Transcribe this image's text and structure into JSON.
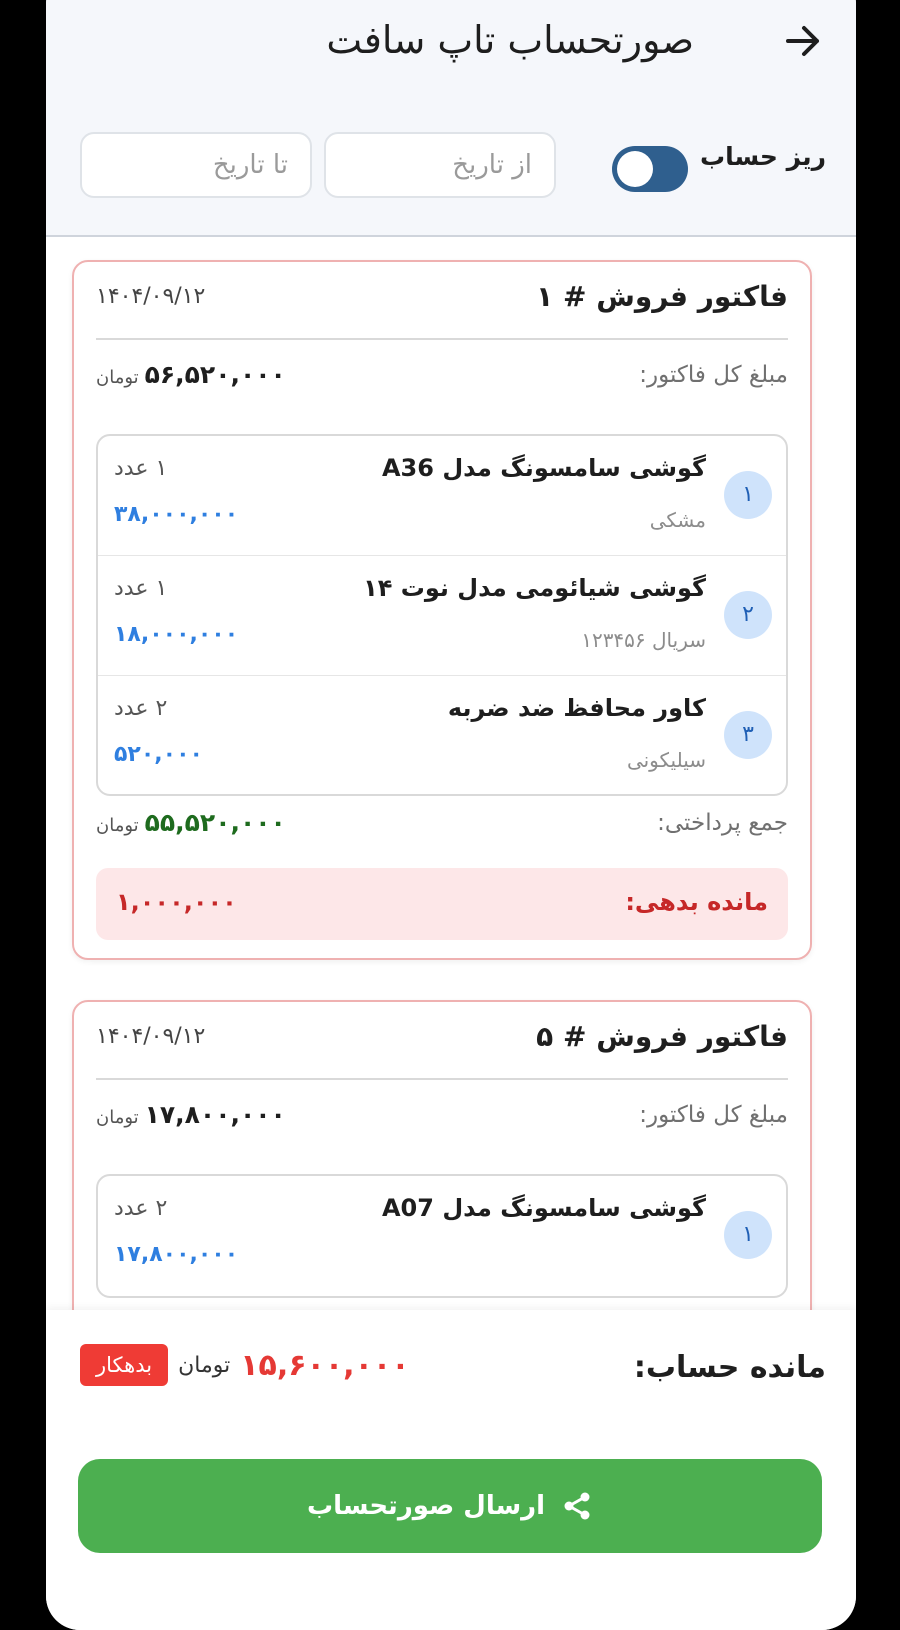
{
  "header": {
    "title": "صورتحساب تاپ سافت",
    "toggle_label": "ریز حساب",
    "from_date_placeholder": "از تاریخ",
    "to_date_placeholder": "تا تاریخ"
  },
  "labels": {
    "invoice_total": "مبلغ کل فاکتور:",
    "paid_total": "جمع پرداختی:",
    "debt": "مانده بدهی:",
    "currency": "تومان"
  },
  "invoices": [
    {
      "title": "فاکتور فروش # ۱",
      "date": "۱۴۰۴/۰۹/۱۲",
      "total": "۵۶,۵۲۰,۰۰۰",
      "items": [
        {
          "index": "۱",
          "name": "گوشی سامسونگ مدل A36",
          "sub": "مشکی",
          "qty": "۱ عدد",
          "price": "۳۸,۰۰۰,۰۰۰"
        },
        {
          "index": "۲",
          "name": "گوشی شیائومی مدل نوت ۱۴",
          "sub": "سریال ۱۲۳۴۵۶",
          "qty": "۱ عدد",
          "price": "۱۸,۰۰۰,۰۰۰"
        },
        {
          "index": "۳",
          "name": "کاور محافظ ضد ضربه",
          "sub": "سیلیکونی",
          "qty": "۲ عدد",
          "price": "۵۲۰,۰۰۰"
        }
      ],
      "paid": "۵۵,۵۲۰,۰۰۰",
      "debt": "۱,۰۰۰,۰۰۰"
    },
    {
      "title": "فاکتور فروش # ۵",
      "date": "۱۴۰۴/۰۹/۱۲",
      "total": "۱۷,۸۰۰,۰۰۰",
      "items": [
        {
          "index": "۱",
          "name": "گوشی سامسونگ مدل A07",
          "qty": "۲ عدد",
          "price": "۱۷,۸۰۰,۰۰۰"
        }
      ]
    }
  ],
  "footer": {
    "balance_label": "مانده حساب:",
    "balance_value": "۱۵,۶۰۰,۰۰۰",
    "currency": "تومان",
    "status_tag": "بدهکار",
    "send_button": "ارسال صورتحساب"
  },
  "colors": {
    "toggle_track": "#2f5f8e",
    "invoice_border": "#efb1b1",
    "price_blue": "#2f7fe0",
    "paid_green": "#1e6b1e",
    "debt_red": "#c62828",
    "send_green": "#4caf50"
  },
  "icons": {
    "back": "arrow-right-icon",
    "share": "share-icon"
  }
}
